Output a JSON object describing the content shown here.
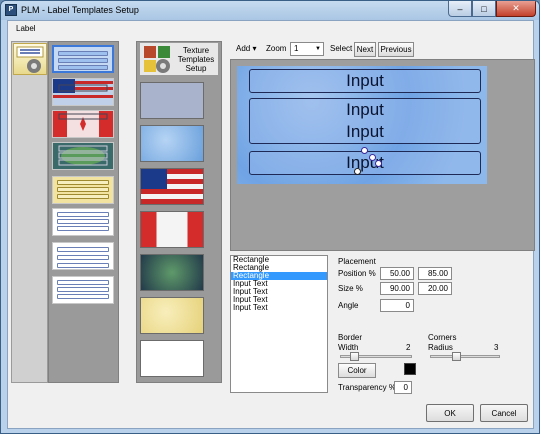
{
  "window": {
    "title": "PLM - Label Templates Setup"
  },
  "menu": {
    "label": "Label"
  },
  "texture_setup": {
    "label": "Texture Templates Setup"
  },
  "toolbar": {
    "add_label": "Add",
    "zoom_label": "Zoom",
    "zoom_value": "1",
    "select_label": "Select",
    "next_label": "Next",
    "previous_label": "Previous"
  },
  "canvas": {
    "boxes": [
      "Input",
      "Input",
      "Input",
      "Input"
    ]
  },
  "elements": [
    "Rectangle",
    "Rectangle",
    "Rectangle",
    "Input Text",
    "Input Text",
    "Input Text",
    "Input Text"
  ],
  "selected_element_index": 2,
  "placement": {
    "title": "Placement",
    "position_label": "Position %",
    "position_x": "50.00",
    "position_y": "85.00",
    "size_label": "Size %",
    "size_x": "90.00",
    "size_y": "20.00",
    "angle_label": "Angle",
    "angle": "0"
  },
  "border": {
    "title": "Border",
    "width_label": "Width",
    "width_value": "2",
    "color_label": "Color",
    "color": "#000000",
    "transparency_label": "Transparency %",
    "transparency": "0"
  },
  "corners": {
    "title": "Corners",
    "radius_label": "Radius",
    "radius_value": "3"
  },
  "buttons": {
    "ok": "OK",
    "cancel": "Cancel"
  }
}
